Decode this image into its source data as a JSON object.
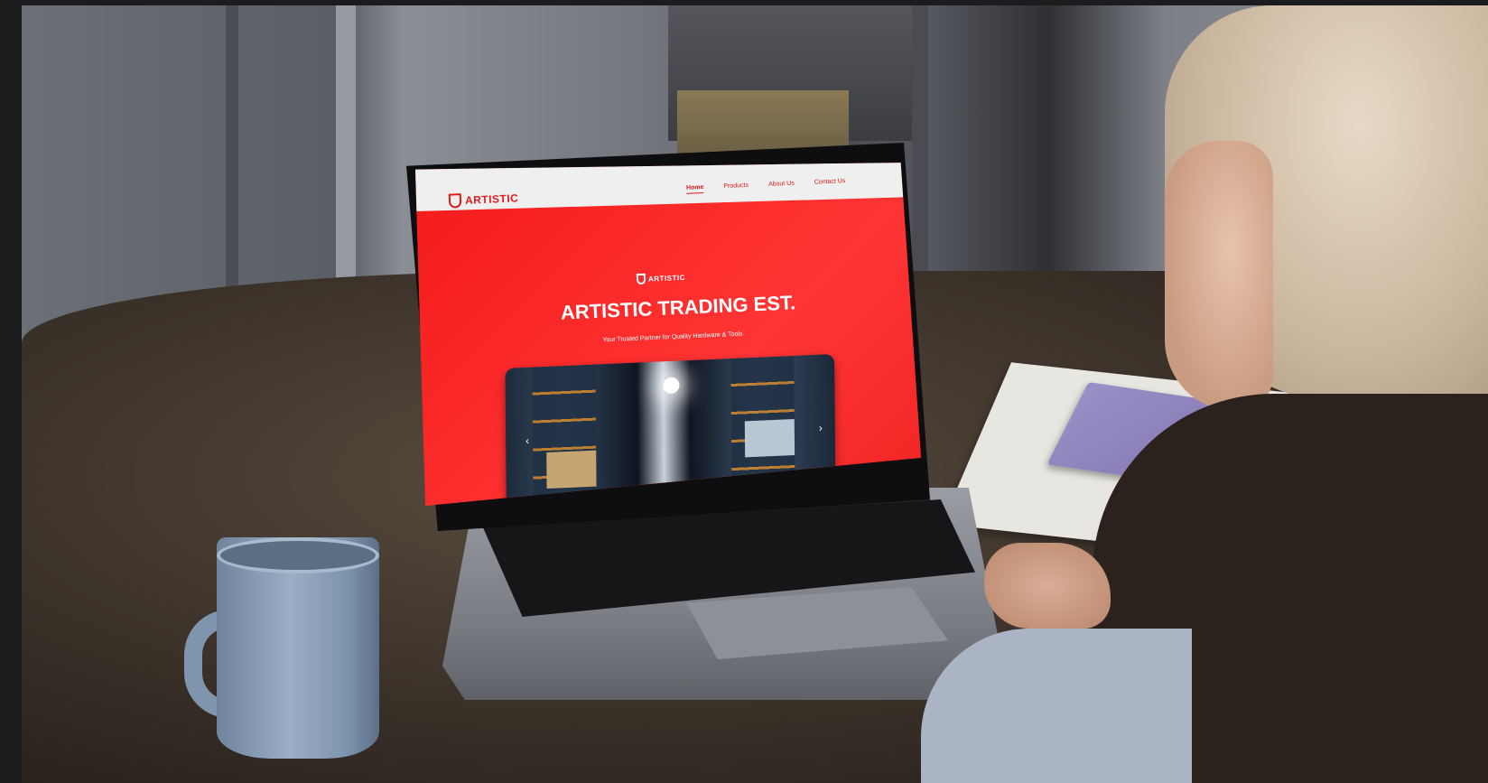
{
  "website": {
    "logo_text": "ARTISTIC",
    "nav": [
      {
        "label": "Home",
        "active": true
      },
      {
        "label": "Products",
        "active": false
      },
      {
        "label": "About Us",
        "active": false
      },
      {
        "label": "Contact Us",
        "active": false
      }
    ],
    "hero": {
      "logo_text": "ARTISTIC",
      "title": "ARTISTIC TRADING EST.",
      "subtitle": "Your Trusted Partner for Quality Hardware & Tools"
    },
    "carousel": {
      "prev_icon": "‹",
      "next_icon": "›",
      "slide_count": 5,
      "active_slide": 3
    },
    "colors": {
      "brand_red": "#f22c2c",
      "header_bg": "#efefef"
    }
  }
}
